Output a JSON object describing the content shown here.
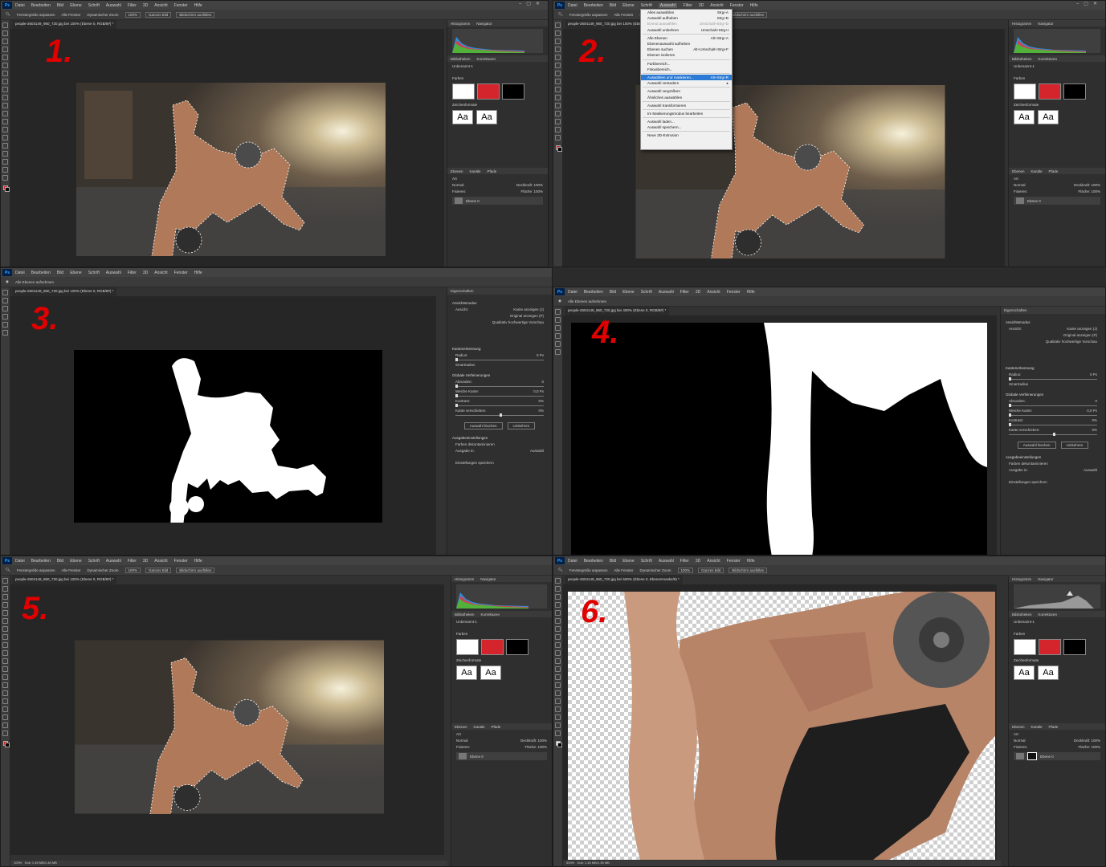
{
  "menu": [
    "Datei",
    "Bearbeiten",
    "Bild",
    "Ebene",
    "Schrift",
    "Auswahl",
    "Filter",
    "3D",
    "Ansicht",
    "Fenster",
    "Hilfe"
  ],
  "options": {
    "fenster_anpassen": "Fenstergröße anpassen",
    "alle_fenster": "Alle Fenster",
    "dyn_zoom": "Dynamischer Zoom",
    "zoom": "100%",
    "ganzes_bild": "Ganzes Bild",
    "bildschirm": "Bildschirm ausfüllen",
    "alle_ebenen": "Alle Ebenen aufnehmen"
  },
  "tabs": {
    "t1": "people-2604149_960_720.jpg bei 100% (Ebene 0, RGB/8#) *",
    "t4": "people-2604149_960_720.jpg bei 400% (Ebene 0, RGB/8#) *",
    "t6": "people-2604149_960_720.jpg bei 500% (Ebene 0, Ebenenmaske/8) *"
  },
  "steps": [
    "1.",
    "2.",
    "3.",
    "4.",
    "5.",
    "6."
  ],
  "right_panel": {
    "histogram": "Histogramm",
    "navigator": "Navigator",
    "bibliotheken": "Bibliotheken",
    "korrekturen": "Korrekturen",
    "unbenannt": "Unbenannt-1",
    "farben": "Farben",
    "zeichenformate": "Zeichenformate",
    "aa": "Aa",
    "ebenen": "Ebenen",
    "kanale": "Kanäle",
    "pfade": "Pfade",
    "art": "Art",
    "normal": "Normal",
    "deckkraft": "Deckkraft: 100%",
    "fixieren": "Fixieren:",
    "flache": "Fläche: 100%",
    "layer_name": "Ebene 0"
  },
  "colors": {
    "white": "#ffffff",
    "red": "#d3252b",
    "black": "#000000",
    "step_red": "#e10000",
    "highlight": "#2a7ad6"
  },
  "dropdown": [
    {
      "label": "Alles auswählen",
      "sc": "Strg+A",
      "state": "normal"
    },
    {
      "label": "Auswahl aufheben",
      "sc": "Strg+D",
      "state": "normal"
    },
    {
      "label": "Erneut auswählen",
      "sc": "Umschalt+Strg+D",
      "state": "dis"
    },
    {
      "label": "Auswahl umkehren",
      "sc": "Umschalt+Strg+I",
      "state": "normal"
    },
    {
      "sep": true
    },
    {
      "label": "Alle Ebenen",
      "sc": "Alt+Strg+A",
      "state": "normal"
    },
    {
      "label": "Ebenenauswahl aufheben",
      "sc": "",
      "state": "normal"
    },
    {
      "label": "Ebenen suchen",
      "sc": "Alt+Umschalt+Strg+F",
      "state": "normal"
    },
    {
      "label": "Ebenen isolieren",
      "sc": "",
      "state": "normal"
    },
    {
      "sep": true
    },
    {
      "label": "Farbbereich...",
      "sc": "",
      "state": "normal"
    },
    {
      "label": "Fokusbereich...",
      "sc": "",
      "state": "normal"
    },
    {
      "sep": true
    },
    {
      "label": "Auswählen und maskieren...",
      "sc": "Alt+Strg+R",
      "state": "hl"
    },
    {
      "label": "Auswahl verändern",
      "sc": "▸",
      "state": "normal"
    },
    {
      "sep": true
    },
    {
      "label": "Auswahl vergrößern",
      "sc": "",
      "state": "normal"
    },
    {
      "label": "Ähnliches auswählen",
      "sc": "",
      "state": "normal"
    },
    {
      "sep": true
    },
    {
      "label": "Auswahl transformieren",
      "sc": "",
      "state": "normal"
    },
    {
      "sep": true
    },
    {
      "label": "Im Maskierungsmodus bearbeiten",
      "sc": "",
      "state": "normal"
    },
    {
      "sep": true
    },
    {
      "label": "Auswahl laden...",
      "sc": "",
      "state": "normal"
    },
    {
      "label": "Auswahl speichern...",
      "sc": "",
      "state": "normal"
    },
    {
      "sep": true
    },
    {
      "label": "Neue 3D-Extrusion",
      "sc": "",
      "state": "normal"
    }
  ],
  "props": {
    "title": "Eigenschaften",
    "ansichtsmodus": "Ansichtsmodus",
    "ansicht": "Ansicht:",
    "kante": "Kante anzeigen (J)",
    "original": "Original anzeigen (P)",
    "qualitat": "Qualitativ hochwertige Vorschau",
    "kantenerkennung": "Kantenerkennung",
    "radius": "Radius:",
    "radius_val": "0 Px",
    "smartradius": "Smartradius",
    "globale": "Globale Verfeinerungen",
    "abrunden": "Abrunden:",
    "weiche": "Weiche Kante:",
    "weiche_val": "0,0 Px",
    "kontrast": "Kontrast:",
    "kante_verschieben": "Kante verschieben:",
    "pct0": "0%",
    "zero": "0",
    "auswahl_loschen": "Auswahl löschen",
    "umkehren": "Umkehren",
    "ausgabe": "Ausgabeeinstellungen",
    "farben_dekont": "Farben dekontaminieren",
    "ausgabe_in": "Ausgabe in:",
    "auswahl": "Auswahl",
    "einst_speichern": "Einstellungen speichern"
  },
  "status": {
    "zoom": "100%",
    "dok": "Dok: 1,46 MB/1,46 MB",
    "zoom6": "500%",
    "dok6": "Dok: 1,46 MB/1,36 MB"
  }
}
